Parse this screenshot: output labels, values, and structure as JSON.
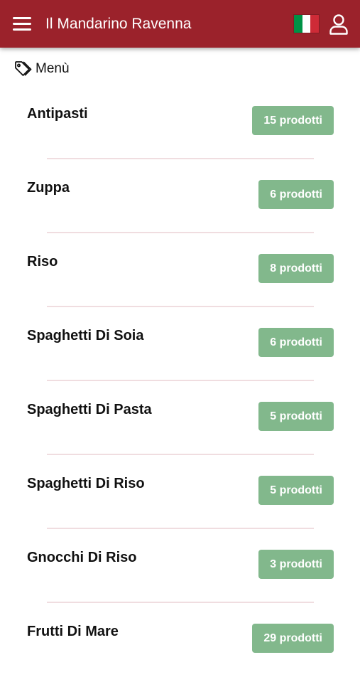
{
  "header": {
    "title": "Il Mandarino Ravenna",
    "background": "#9b222b",
    "menu_icon": "hamburger-menu-icon",
    "language_flag": {
      "country": "it",
      "colors": [
        "#009246",
        "#ffffff",
        "#ce2b37"
      ]
    },
    "user_icon": "user-icon"
  },
  "breadcrumb": {
    "icon": "tag-icon",
    "label": "Menù"
  },
  "badge_color": "#82b88c",
  "categories": [
    {
      "name": "Antipasti",
      "count": "15 prodotti"
    },
    {
      "name": "Zuppa",
      "count": "6 prodotti"
    },
    {
      "name": "Riso",
      "count": "8 prodotti"
    },
    {
      "name": "Spaghetti Di Soia",
      "count": "6 prodotti"
    },
    {
      "name": "Spaghetti Di Pasta",
      "count": "5 prodotti"
    },
    {
      "name": "Spaghetti Di Riso",
      "count": "5 prodotti"
    },
    {
      "name": "Gnocchi Di Riso",
      "count": "3 prodotti"
    },
    {
      "name": "Frutti Di Mare",
      "count": "29 prodotti"
    }
  ]
}
